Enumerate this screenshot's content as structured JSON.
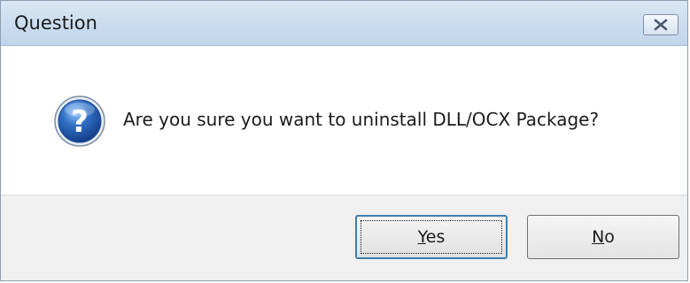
{
  "dialog": {
    "title": "Question",
    "close_icon": "close-x-icon",
    "message": "Are you sure you want to uninstall DLL/OCX Package?",
    "icon": "question-icon",
    "accent_color": "#2f6fc3"
  },
  "buttons": {
    "yes": {
      "mnemonic": "Y",
      "rest": "es"
    },
    "no": {
      "mnemonic": "N",
      "rest": "o"
    }
  }
}
